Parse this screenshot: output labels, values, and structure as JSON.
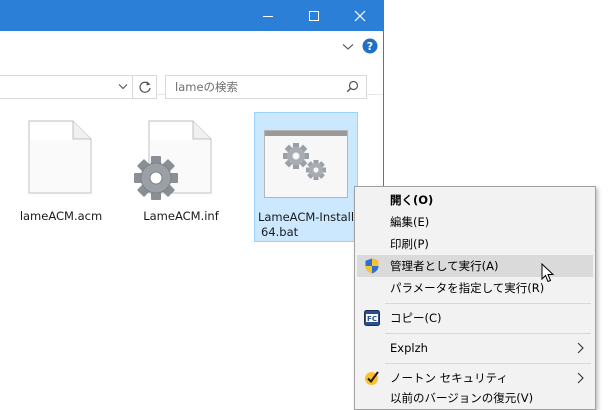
{
  "window": {
    "search_placeholder": "lameの検索"
  },
  "files": [
    {
      "name": "lameACM.acm"
    },
    {
      "name": "LameACM.inf"
    },
    {
      "name_line1": "LameACM-Install",
      "name_line2": "64.bat"
    }
  ],
  "context_menu": {
    "items": [
      {
        "label": "開く(O)"
      },
      {
        "label": "編集(E)"
      },
      {
        "label": "印刷(P)"
      },
      {
        "label": "管理者として実行(A)"
      },
      {
        "label": "パラメータを指定して実行(R)"
      },
      {
        "label": "コピー(C)"
      },
      {
        "label": "Explzh"
      },
      {
        "label": "ノートン セキュリティ"
      },
      {
        "label": "以前のバージョンの復元(V)"
      }
    ]
  },
  "colors": {
    "titlebar": "#2b7fd6",
    "selection_fill": "#cce8ff",
    "selection_border": "#99d1ff",
    "menu_bg": "#f2f2f2",
    "menu_highlight": "#dadada"
  }
}
